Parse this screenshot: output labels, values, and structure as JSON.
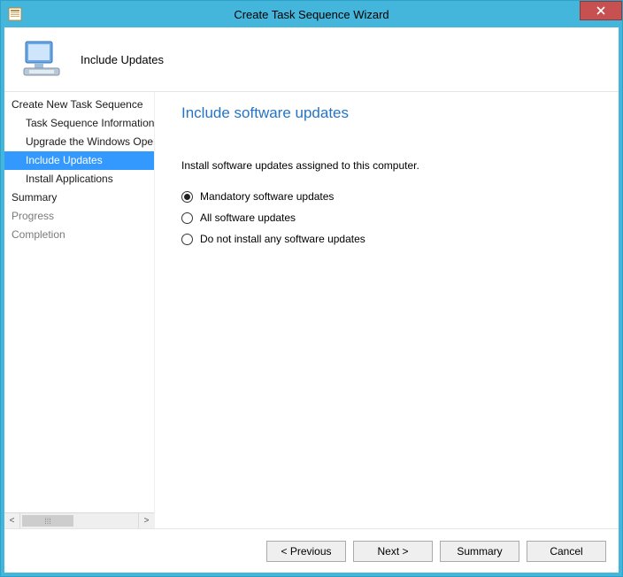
{
  "window": {
    "title": "Create Task Sequence Wizard"
  },
  "header": {
    "label": "Include Updates"
  },
  "sidebar": {
    "items": [
      {
        "label": "Create New Task Sequence",
        "level": 0,
        "state": "normal"
      },
      {
        "label": "Task Sequence Information",
        "level": 1,
        "state": "normal"
      },
      {
        "label": "Upgrade the Windows Operating System",
        "level": 1,
        "state": "normal"
      },
      {
        "label": "Include Updates",
        "level": 1,
        "state": "selected"
      },
      {
        "label": "Install Applications",
        "level": 1,
        "state": "normal"
      },
      {
        "label": "Summary",
        "level": 0,
        "state": "normal"
      },
      {
        "label": "Progress",
        "level": 0,
        "state": "disabled"
      },
      {
        "label": "Completion",
        "level": 0,
        "state": "disabled"
      }
    ],
    "scroll_left_glyph": "<",
    "scroll_right_glyph": ">",
    "scroll_thumb_glyph": "⁞⁞⁞"
  },
  "content": {
    "title": "Include software updates",
    "instruction": "Install software updates assigned to this computer.",
    "options": [
      {
        "label": "Mandatory software updates",
        "checked": true
      },
      {
        "label": "All software updates",
        "checked": false
      },
      {
        "label": "Do not install any software updates",
        "checked": false
      }
    ]
  },
  "footer": {
    "previous": "< Previous",
    "next": "Next >",
    "summary": "Summary",
    "cancel": "Cancel"
  }
}
